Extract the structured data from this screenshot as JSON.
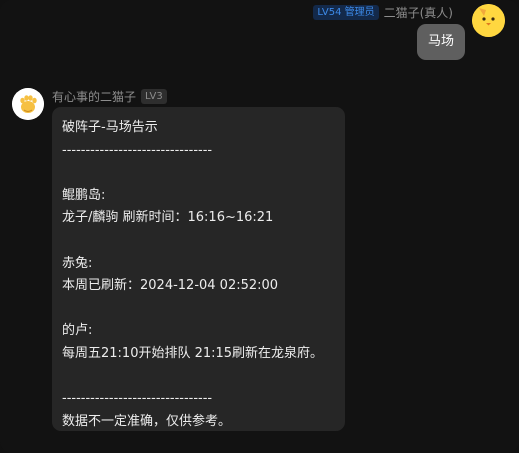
{
  "self_message": {
    "badge": "LV54 管理员",
    "name": "二猫子(真人)",
    "text": "马场",
    "avatar_icon": "yellow-chick-avatar"
  },
  "bot_message": {
    "name": "有心事的二猫子",
    "level": "LV3",
    "avatar_icon": "cat-paw-avatar",
    "lines": [
      "破阵子-马场告示",
      "--------------------------------",
      "",
      "鲲鹏岛:",
      "龙子/麟驹 刷新时间：16:16~16:21",
      "",
      "赤兔:",
      "本周已刷新：2024-12-04 02:52:00",
      "",
      "的卢:",
      "每周五21:10开始排队 21:15刷新在龙泉府。",
      "",
      "--------------------------------",
      "数据不一定准确，仅供参考。"
    ]
  },
  "colors": {
    "background": "#121212",
    "bot_bubble": "#262626",
    "self_bubble": "#5f5f5f",
    "admin_badge_text": "#3d8ae8",
    "self_avatar": "#ffd740"
  }
}
